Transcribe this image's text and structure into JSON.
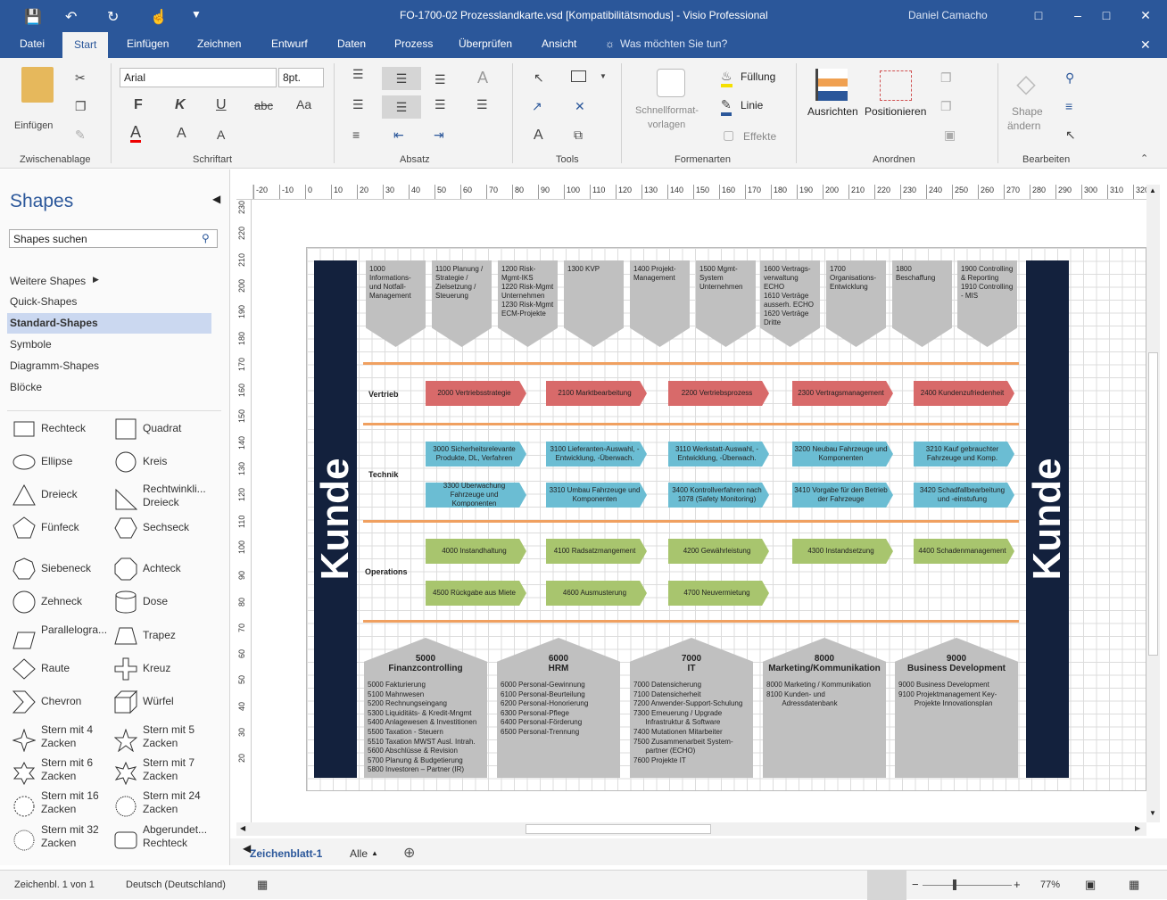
{
  "window": {
    "title": "FO-1700-02 Prozesslandkarte.vsd  [Kompatibilitätsmodus]  -  Visio Professional",
    "user": "Daniel Camacho"
  },
  "tabs": [
    "Datei",
    "Start",
    "Einfügen",
    "Zeichnen",
    "Entwurf",
    "Daten",
    "Prozess",
    "Überprüfen",
    "Ansicht"
  ],
  "tell_me": "Was möchten Sie tun?",
  "ribbon": {
    "clipboard": {
      "paste": "Einfügen",
      "label": "Zwischenablage"
    },
    "font": {
      "name": "Arial",
      "size": "8pt.",
      "bold": "F",
      "italic": "K",
      "underline": "U",
      "strike": "abc",
      "case": "Aa",
      "color": "A",
      "grow": "A",
      "shrink": "A",
      "label": "Schriftart"
    },
    "paragraph": {
      "label": "Absatz"
    },
    "tools": {
      "label": "Tools",
      "text": "A"
    },
    "styles": {
      "quick": "Schnellformat-",
      "quick2": "vorlagen",
      "fill": "Füllung",
      "line": "Linie",
      "effects": "Effekte",
      "label": "Formenarten"
    },
    "arrange": {
      "align": "Ausrichten",
      "position": "Positionieren",
      "label": "Anordnen"
    },
    "edit": {
      "change": "Shape",
      "change2": "ändern",
      "label": "Bearbeiten"
    }
  },
  "shapes": {
    "title": "Shapes",
    "search_placeholder": "Shapes suchen",
    "nav": [
      "Weitere Shapes",
      "Quick-Shapes",
      "Standard-Shapes",
      "Symbole",
      "Diagramm-Shapes",
      "Blöcke"
    ],
    "items": [
      {
        "n": "Rechteck",
        "k": "rect"
      },
      {
        "n": "Quadrat",
        "k": "square"
      },
      {
        "n": "Ellipse",
        "k": "ellipse"
      },
      {
        "n": "Kreis",
        "k": "circle"
      },
      {
        "n": "Dreieck",
        "k": "triangle"
      },
      {
        "n": "Rechtwinkli... Dreieck",
        "k": "rtri"
      },
      {
        "n": "Fünfeck",
        "k": "pentagon"
      },
      {
        "n": "Sechseck",
        "k": "hexagon"
      },
      {
        "n": "Siebeneck",
        "k": "heptagon"
      },
      {
        "n": "Achteck",
        "k": "octagon"
      },
      {
        "n": "Zehneck",
        "k": "decagon"
      },
      {
        "n": "Dose",
        "k": "can"
      },
      {
        "n": "Parallelogra...",
        "k": "para"
      },
      {
        "n": "Trapez",
        "k": "trap"
      },
      {
        "n": "Raute",
        "k": "diamond"
      },
      {
        "n": "Kreuz",
        "k": "cross"
      },
      {
        "n": "Chevron",
        "k": "chevron"
      },
      {
        "n": "Würfel",
        "k": "cube"
      },
      {
        "n": "Stern mit 4 Zacken",
        "k": "star4"
      },
      {
        "n": "Stern mit 5 Zacken",
        "k": "star5"
      },
      {
        "n": "Stern mit 6 Zacken",
        "k": "star6"
      },
      {
        "n": "Stern mit 7 Zacken",
        "k": "star7"
      },
      {
        "n": "Stern mit 16 Zacken",
        "k": "star16"
      },
      {
        "n": "Stern mit 24 Zacken",
        "k": "star24"
      },
      {
        "n": "Stern mit 32 Zacken",
        "k": "star32"
      },
      {
        "n": "Abgerundet... Rechteck",
        "k": "rrect"
      }
    ]
  },
  "ruler": {
    "h": [
      "-20",
      "-10",
      "0",
      "10",
      "20",
      "30",
      "40",
      "50",
      "60",
      "70",
      "80",
      "90",
      "100",
      "110",
      "120",
      "130",
      "140",
      "150",
      "160",
      "170",
      "180",
      "190",
      "200",
      "210",
      "220",
      "230",
      "240",
      "250",
      "260",
      "270",
      "280",
      "290",
      "300",
      "310",
      "320"
    ],
    "v": [
      "230",
      "220",
      "210",
      "200",
      "190",
      "180",
      "170",
      "160",
      "150",
      "140",
      "130",
      "120",
      "110",
      "100",
      "90",
      "80",
      "70",
      "60",
      "50",
      "40",
      "30",
      "20"
    ]
  },
  "diagram": {
    "kunde": "Kunde",
    "top": [
      "1000 Informations- und Notfall-Management",
      "1100 Planung / Strategie / Zielsetzung / Steuerung",
      "1200 Risk-Mgmt-IKS\n1220 Risk-Mgmt Unternehmen\n1230 Risk-Mgmt ECM-Projekte",
      "1300 KVP",
      "1400 Projekt-Management",
      "1500 Mgmt-System Unternehmen",
      "1600 Vertrags-verwaltung ECHO\n1610 Verträge ausserh. ECHO\n1620 Verträge Dritte",
      "1700 Organisations-Entwicklung",
      "1800 Beschaffung",
      "1900 Controlling & Reporting\n1910 Controlling - MIS"
    ],
    "rows": {
      "vertrieb": "Vertrieb",
      "technik": "Technik",
      "operations": "Operations"
    },
    "vertrieb": [
      "2000 Vertriebsstrategie",
      "2100 Marktbearbeitung",
      "2200 Vertriebsprozess",
      "2300 Vertragsmanagement",
      "2400 Kundenzufriedenheit"
    ],
    "technik1": [
      "3000 Sicherheitsrelevante Produkte, DL, Verfahren",
      "3100 Lieferanten-Auswahl, -Entwicklung, -Überwach.",
      "3110 Werkstatt-Auswahl, -Entwicklung, -Überwach.",
      "3200 Neubau Fahrzeuge und Komponenten",
      "3210 Kauf gebrauchter Fahrzeuge und Komp."
    ],
    "technik2": [
      "3300 Überwachung Fahrzeuge und Komponenten",
      "3310 Umbau Fahrzeuge und Komponenten",
      "3400 Kontrollverfahren nach 1078 (Safety Monitoring)",
      "3410 Vorgabe für den Betrieb der Fahrzeuge",
      "3420 Schadfallbearbeitung und -einstufung"
    ],
    "ops1": [
      "4000 Instandhaltung",
      "4100 Radsatzmangement",
      "4200 Gewährleistung",
      "4300 Instandsetzung",
      "4400 Schadenmanagement"
    ],
    "ops2": [
      "4500 Rückgabe aus Miete",
      "4600 Ausmusterung",
      "4700 Neuvermietung"
    ],
    "houses": [
      {
        "num": "5000",
        "name": "Finanzcontrolling",
        "items": [
          "5000 Fakturierung",
          "5100 Mahnwesen",
          "5200 Rechnungseingang",
          "5300 Liquiditäts- & Kredit-Mngmt",
          "5400 Anlagewesen & Investitionen",
          "5500 Taxation - Steuern",
          "5510 Taxation MWST Ausl. Intrah.",
          "5600 Abschlüsse & Revision",
          "5700 Planung & Budgetierung",
          "5800 Investoren – Partner (IR)"
        ]
      },
      {
        "num": "6000",
        "name": "HRM",
        "items": [
          "6000 Personal-Gewinnung",
          "6100 Personal-Beurteilung",
          "6200 Personal-Honorierung",
          "6300 Personal-Pflege",
          "6400 Personal-Förderung",
          "6500 Personal-Trennung"
        ]
      },
      {
        "num": "7000",
        "name": "IT",
        "items": [
          "7000 Datensicherung",
          "7100 Datensicherheit",
          "7200 Anwender-Support-Schulung",
          "7300 Erneuerung / Upgrade",
          "      Infrastruktur & Software",
          "7400 Mutationen Mitarbeiter",
          "7500 Zusammenarbeit System-",
          "      partner (ECHO)",
          "7600 Projekte IT"
        ]
      },
      {
        "num": "8000",
        "name": "Marketing/Kommunikation",
        "items": [
          "8000 Marketing / Kommunikation",
          "8100 Kunden- und",
          "        Adressdatenbank"
        ]
      },
      {
        "num": "9000",
        "name": "Business Development",
        "items": [
          "9000 Business Development",
          "9100 Projektmanagement Key-",
          "        Projekte Innovationsplan"
        ]
      }
    ]
  },
  "sheet": {
    "name": "Zeichenblatt-1",
    "all": "Alle"
  },
  "status": {
    "page": "Zeichenbl. 1 von 1",
    "lang": "Deutsch (Deutschland)",
    "zoom": "77%"
  },
  "colors": {
    "accent": "#2b579a",
    "dark": "#13213d",
    "red": "#d86a6a",
    "blue": "#6bbdd3",
    "green": "#a8c56e",
    "orange": "#f0a060"
  }
}
